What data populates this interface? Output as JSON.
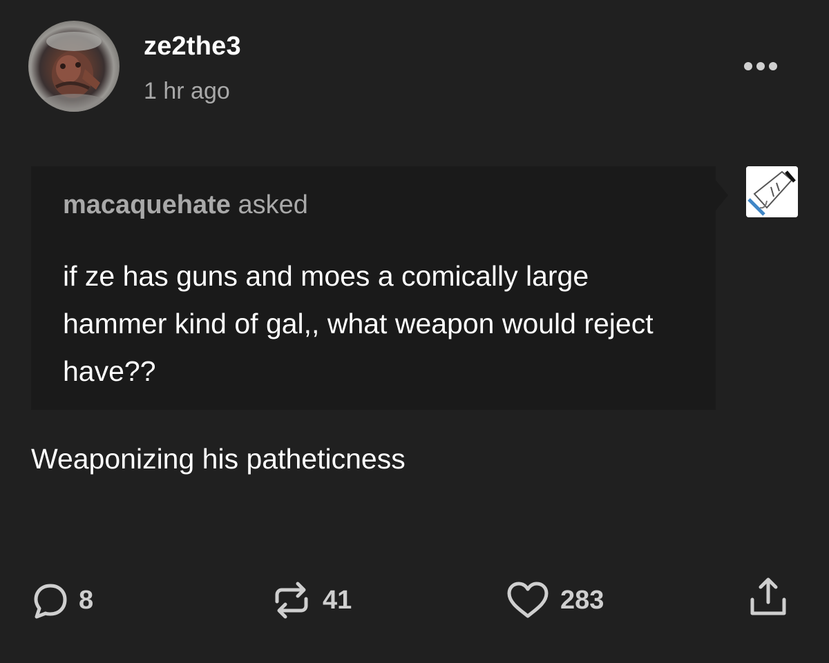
{
  "post": {
    "author": "ze2the3",
    "time_ago": "1 hr ago",
    "more_icon": "more-horizontal-icon"
  },
  "ask": {
    "asker": "macaquehate",
    "asked_label": "asked",
    "question": "if ze has guns and moes a comically large hammer kind of gal,, what weapon would reject have??"
  },
  "answer": {
    "text": "Weaponizing his patheticness"
  },
  "actions": {
    "replies": "8",
    "reblogs": "41",
    "likes": "283"
  },
  "colors": {
    "background": "#202020",
    "ask_bubble": "#1a1a1a",
    "secondary_text": "#a9a9a9",
    "primary_text": "#ffffff"
  }
}
